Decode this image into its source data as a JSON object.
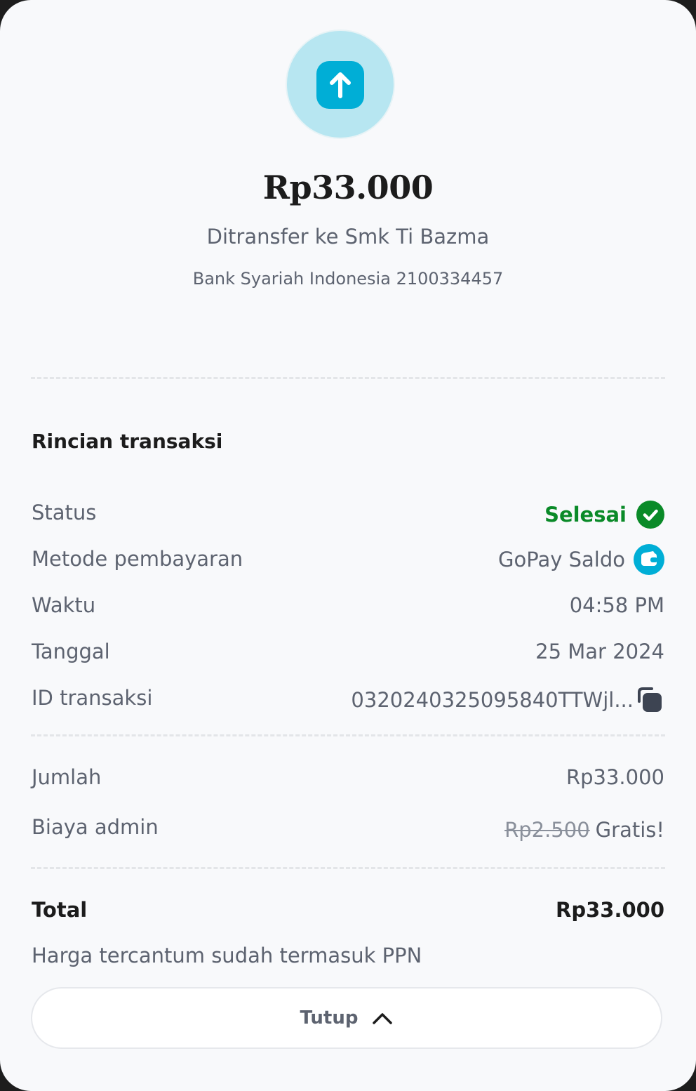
{
  "transfer": {
    "amount": "Rp33.000",
    "recipient_line": "Ditransfer ke Smk Ti Bazma",
    "bank_line": "Bank Syariah Indonesia 2100334457",
    "icon": "arrow-up-icon"
  },
  "details": {
    "title": "Rincian transaksi",
    "rows": [
      {
        "label": "Status",
        "value": "Selesai",
        "icon": "check-circle-icon",
        "status_color": "#0a8a28"
      },
      {
        "label": "Metode pembayaran",
        "value": "GoPay Saldo",
        "icon": "wallet-icon"
      },
      {
        "label": "Waktu",
        "value": "04:58 PM"
      },
      {
        "label": "Tanggal",
        "value": "25 Mar 2024"
      },
      {
        "label": "ID transaksi",
        "value": "0320240325095840TTWjl...",
        "icon": "copy-icon"
      }
    ]
  },
  "charges": {
    "amount_label": "Jumlah",
    "amount_value": "Rp33.000",
    "fee_label": "Biaya admin",
    "fee_original": "Rp2.500",
    "fee_value": "Gratis!"
  },
  "total": {
    "label": "Total",
    "value": "Rp33.000",
    "note": "Harga tercantum sudah termasuk PPN"
  },
  "close_button": {
    "label": "Tutup",
    "icon": "chevron-up-icon"
  },
  "colors": {
    "accent": "#00aed6",
    "success": "#0a8a28",
    "background": "#f8f9fb"
  }
}
